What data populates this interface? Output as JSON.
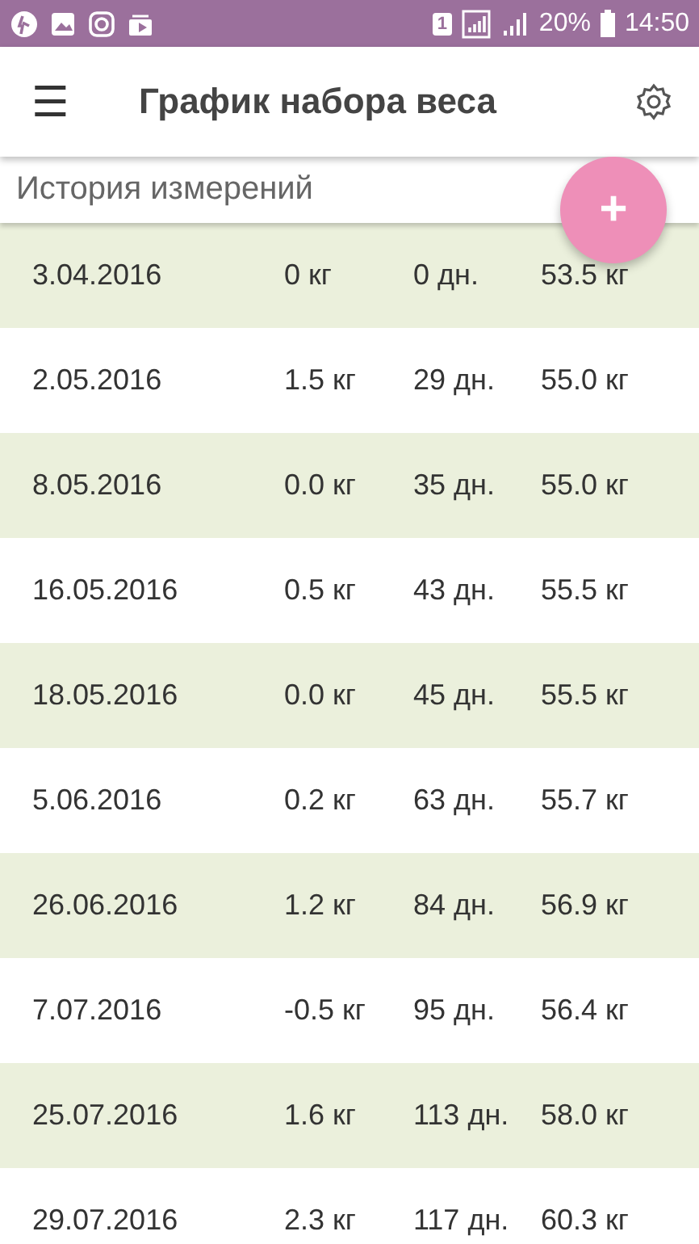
{
  "status_bar": {
    "sim": "1",
    "battery": "20%",
    "time": "14:50"
  },
  "app_bar": {
    "menu": "☰",
    "title": "График набора веса"
  },
  "section": {
    "title": "История измерений"
  },
  "fab": {
    "label": "+"
  },
  "rows": [
    {
      "date": "3.04.2016",
      "change": "0 кг",
      "days": "0 дн.",
      "weight": "53.5 кг"
    },
    {
      "date": "2.05.2016",
      "change": "1.5 кг",
      "days": "29 дн.",
      "weight": "55.0 кг"
    },
    {
      "date": "8.05.2016",
      "change": "0.0 кг",
      "days": "35 дн.",
      "weight": "55.0 кг"
    },
    {
      "date": "16.05.2016",
      "change": "0.5 кг",
      "days": "43 дн.",
      "weight": "55.5 кг"
    },
    {
      "date": "18.05.2016",
      "change": "0.0 кг",
      "days": "45 дн.",
      "weight": "55.5 кг"
    },
    {
      "date": "5.06.2016",
      "change": "0.2 кг",
      "days": "63 дн.",
      "weight": "55.7 кг"
    },
    {
      "date": "26.06.2016",
      "change": "1.2 кг",
      "days": "84 дн.",
      "weight": "56.9 кг"
    },
    {
      "date": "7.07.2016",
      "change": "-0.5 кг",
      "days": "95 дн.",
      "weight": "56.4 кг"
    },
    {
      "date": "25.07.2016",
      "change": "1.6 кг",
      "days": "113 дн.",
      "weight": "58.0 кг"
    },
    {
      "date": "29.07.2016",
      "change": "2.3 кг",
      "days": "117 дн.",
      "weight": "60.3 кг"
    }
  ]
}
